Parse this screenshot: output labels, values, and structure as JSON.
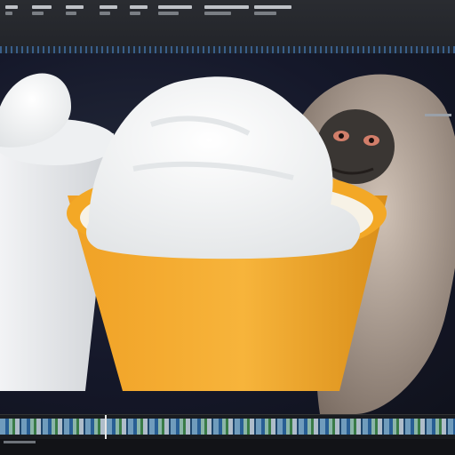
{
  "app": {
    "menu": [
      {
        "id": "menu-1"
      },
      {
        "id": "menu-2"
      },
      {
        "id": "menu-3"
      },
      {
        "id": "menu-4"
      },
      {
        "id": "menu-5"
      },
      {
        "id": "menu-6"
      },
      {
        "id": "menu-7"
      },
      {
        "id": "menu-8"
      }
    ]
  },
  "colors": {
    "ui_dark": "#23252a",
    "canvas_bg": "#15182a",
    "cup_white": "#e9ebee",
    "cup_orange": "#f3a826",
    "cream": "#f6f6f4",
    "fur": "#b8a89c"
  },
  "canvas": {
    "objects": [
      "white-cup",
      "orange-cup",
      "whipped-cream",
      "monkey"
    ]
  }
}
